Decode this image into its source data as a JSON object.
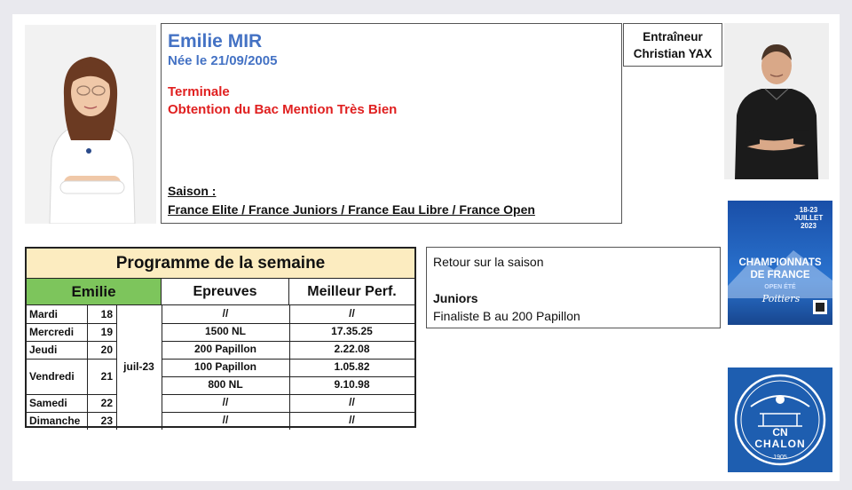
{
  "athlete": {
    "name": "Emilie MIR",
    "born": "Née le 21/09/2005",
    "school_level": "Terminale",
    "achievement": "Obtention du Bac Mention Très Bien",
    "season_label": "Saison :",
    "season_competitions": "France Elite / France Juniors / France Eau Libre / France Open"
  },
  "coach": {
    "title": "Entraîneur",
    "name": "Christian YAX"
  },
  "programme": {
    "title": "Programme de la semaine",
    "athlete_header": "Emilie",
    "col_events": "Epreuves",
    "col_best": "Meilleur Perf.",
    "month": "juil-23",
    "rows": [
      {
        "day": "Mardi",
        "date": "18",
        "event": "//",
        "best": "//"
      },
      {
        "day": "Mercredi",
        "date": "19",
        "event": "1500 NL",
        "best": "17.35.25"
      },
      {
        "day": "Jeudi",
        "date": "20",
        "event": "200 Papillon",
        "best": "2.22.08"
      },
      {
        "day": "Vendredi",
        "date": "21",
        "event": "100 Papillon",
        "best": "1.05.82"
      },
      {
        "day": "",
        "date": "",
        "event": "800 NL",
        "best": "9.10.98"
      },
      {
        "day": "Samedi",
        "date": "22",
        "event": "//",
        "best": "//"
      },
      {
        "day": "Dimanche",
        "date": "23",
        "event": "//",
        "best": "//"
      }
    ]
  },
  "review": {
    "heading": "Retour sur la saison",
    "category": "Juniors",
    "result": "Finaliste B au 200 Papillon"
  },
  "poster": {
    "dates": "18-23 JUILLET 2023",
    "title_line1": "CHAMPIONNATS",
    "title_line2": "DE FRANCE",
    "subtitle": "OPEN ÉTÉ",
    "city": "Poitiers"
  },
  "club_logo": {
    "line1": "CN",
    "line2": "CHALON",
    "year": "1905"
  },
  "colors": {
    "name_blue": "#4472c4",
    "accent_red": "#e02020",
    "title_band": "#fcecc0",
    "athlete_green": "#7dc55c",
    "logo_blue": "#1e5eb0"
  }
}
